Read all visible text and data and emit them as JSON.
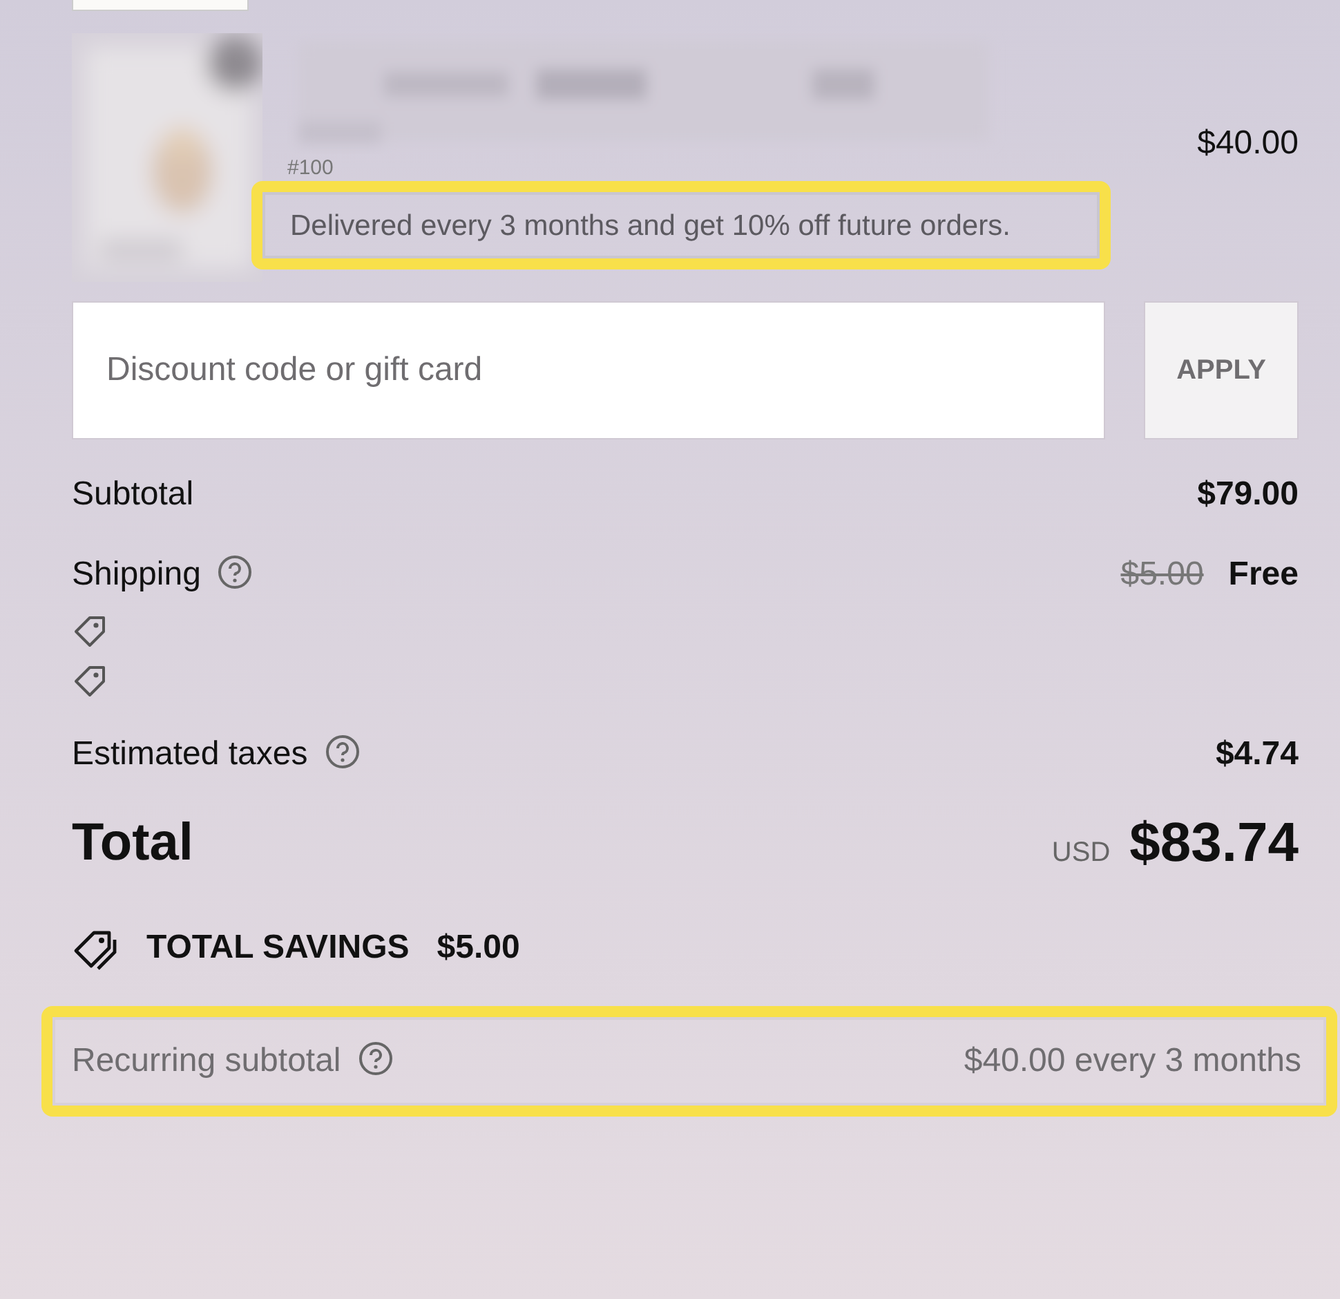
{
  "product": {
    "kind": "picture",
    "variant": "#100",
    "price": "$40.00",
    "note": "Delivered every 3 months and get 10% off future orders.",
    "note_highlighted": true
  },
  "discount": {
    "placeholder": "Discount code or gift card",
    "button": "APPLY"
  },
  "summary": [
    {
      "label": "Subtotal",
      "help": false,
      "value": "$79.00"
    },
    {
      "label": "Shipping",
      "help": true,
      "original": "$5.00",
      "value": "Free"
    }
  ],
  "discount_lines": [
    {
      "kind": "tag"
    },
    {
      "kind": "tag"
    }
  ],
  "taxes": {
    "label": "Estimated taxes",
    "help": true,
    "value": "$4.74"
  },
  "total": {
    "label": "Total",
    "currency": "USD",
    "value": "$83.74"
  },
  "savings": {
    "label": "TOTAL SAVINGS",
    "value": "$5.00"
  },
  "recurring": {
    "label": "Recurring subtotal",
    "help": true,
    "value": "$40.00 every 3 months",
    "highlighted": true
  }
}
